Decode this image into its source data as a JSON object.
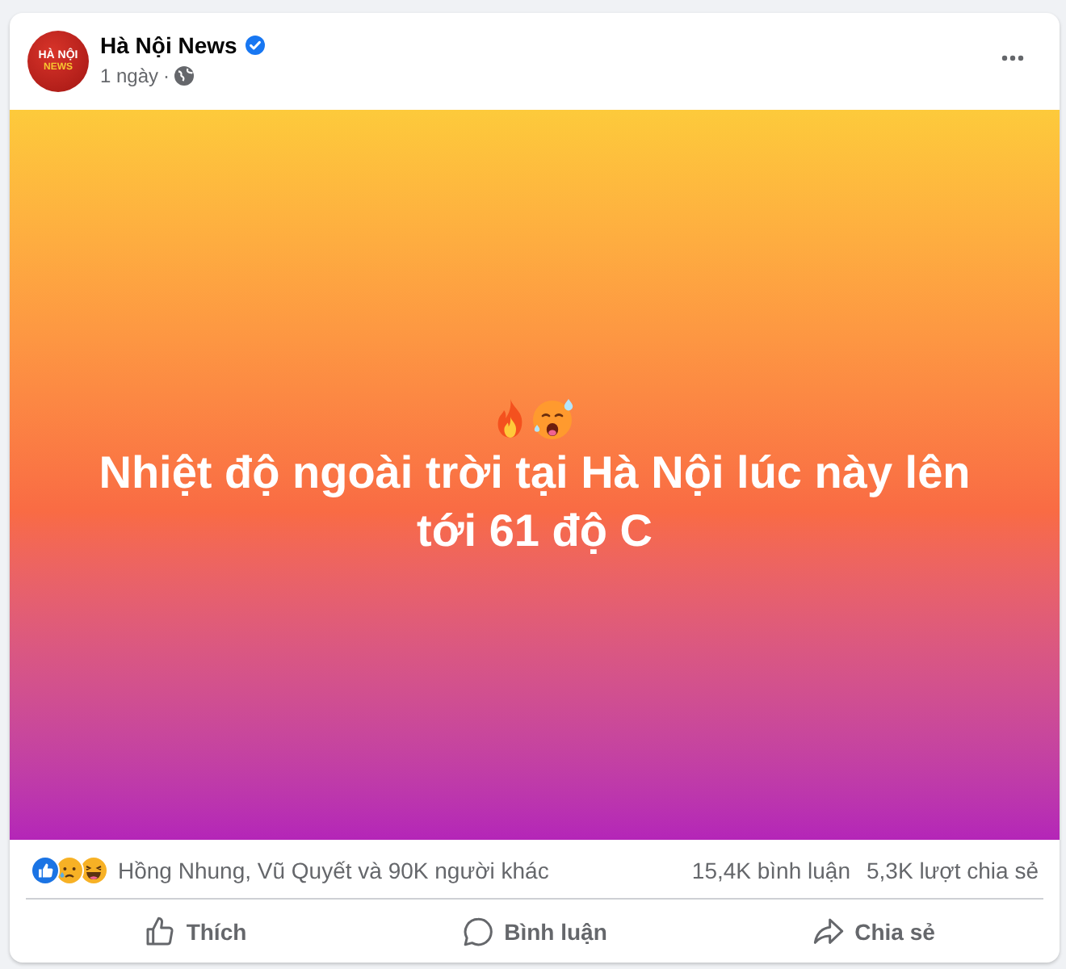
{
  "post": {
    "avatar": {
      "line_1": "HÀ NỘI",
      "line_2": "NEWS"
    },
    "author": "Hà Nội News",
    "verified": true,
    "time": "1 ngày",
    "time_separator": "·"
  },
  "body": {
    "text": "Nhiệt độ ngoài trời tại Hà Nội lúc này lên tới 61 độ C"
  },
  "stats": {
    "reaction_summary": "Hồng Nhung, Vũ Quyết và 90K người khác",
    "comments": "15,4K bình luận",
    "shares": "5,3K lượt chia sẻ"
  },
  "actions": [
    {
      "kind": "like",
      "label": "Thích"
    },
    {
      "kind": "comment",
      "label": "Bình luận"
    },
    {
      "kind": "share",
      "label": "Chia sẻ"
    }
  ]
}
